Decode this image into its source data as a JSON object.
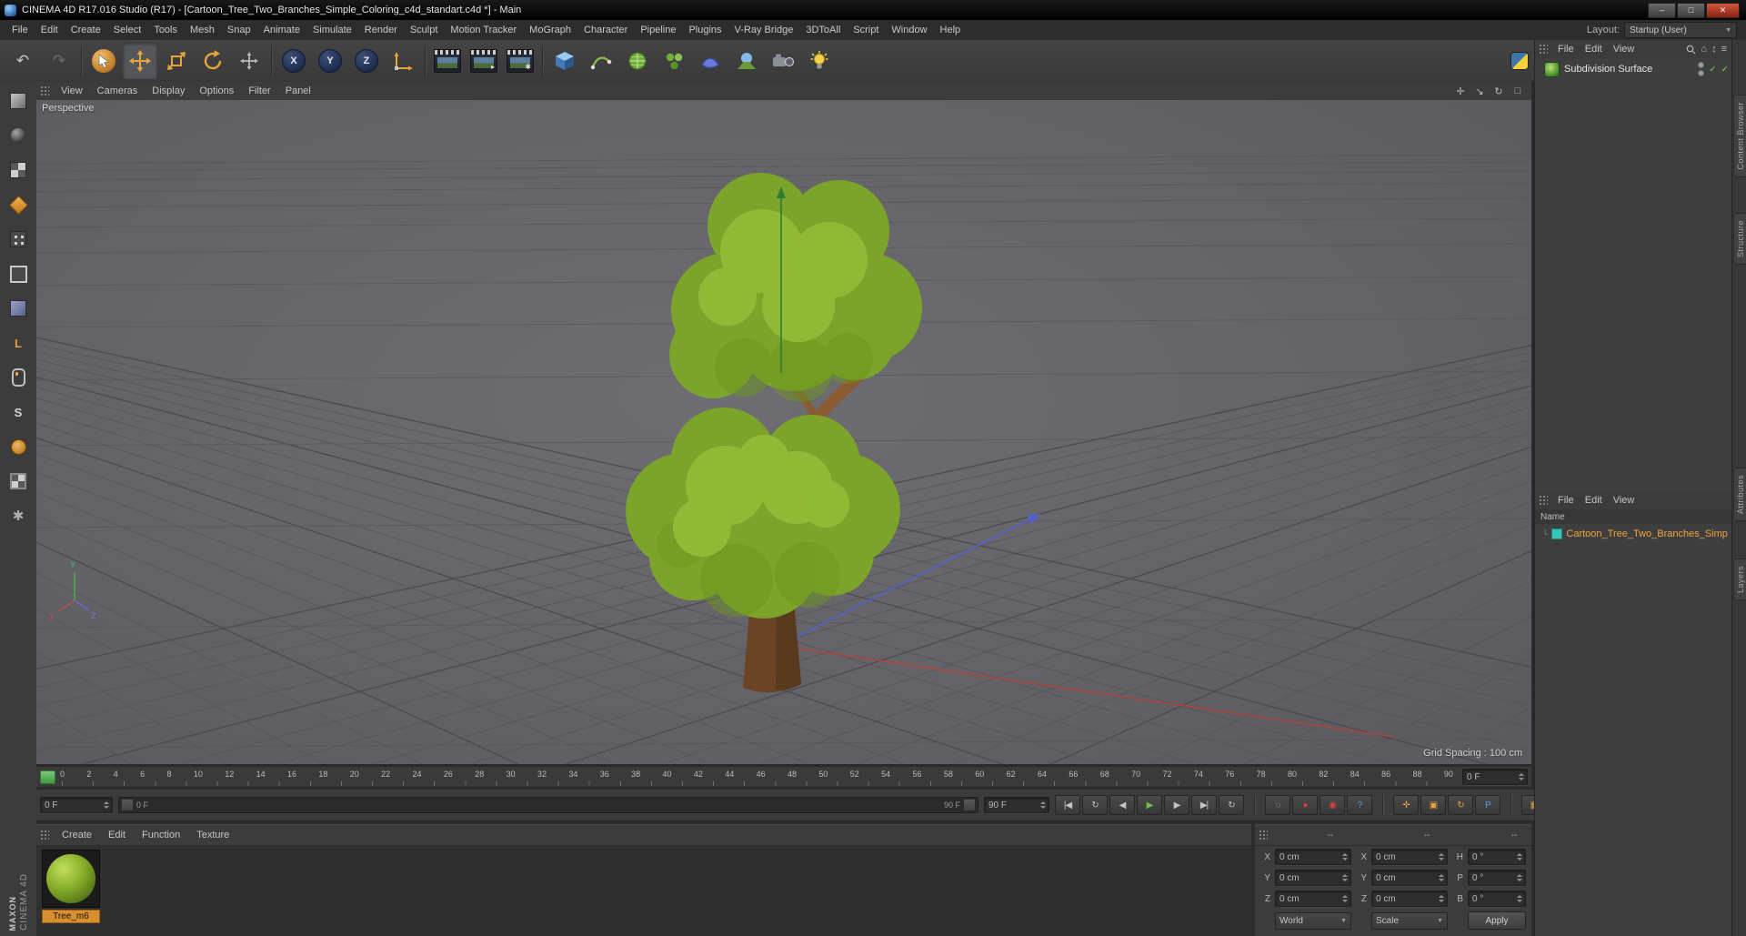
{
  "colors": {
    "accent_orange": "#e8a33c",
    "selection_orange": "#d98e2f",
    "play_green": "#6cc04a",
    "record_red": "#e04040",
    "axis_red": "#a8463c",
    "axis_green": "#2e7d32",
    "axis_blue": "#5560c8",
    "item_teal": "#35c4b5"
  },
  "window": {
    "title": "CINEMA 4D R17.016 Studio (R17) - [Cartoon_Tree_Two_Branches_Simple_Coloring_c4d_standart.c4d *] - Main",
    "minimize": "–",
    "maximize": "□",
    "close": "✕"
  },
  "menubar": {
    "items": [
      "File",
      "Edit",
      "Create",
      "Select",
      "Tools",
      "Mesh",
      "Snap",
      "Animate",
      "Simulate",
      "Render",
      "Sculpt",
      "Motion Tracker",
      "MoGraph",
      "Character",
      "Pipeline",
      "Plugins",
      "V-Ray Bridge",
      "3DToAll",
      "Script",
      "Window",
      "Help"
    ],
    "layout_label": "Layout:",
    "layout_value": "Startup (User)",
    "dropdown_arrow": "▼"
  },
  "toolbar": {
    "undo": "↶",
    "redo": "↷",
    "axis_x": "X",
    "axis_y": "Y",
    "axis_z": "Z",
    "render_settings_badge": "✱",
    "render_pv_badge": "▸"
  },
  "left_palette": {
    "workplane_letter": "L",
    "snap_letter": "S",
    "gear_glyph": "✱"
  },
  "viewport": {
    "menu": [
      "View",
      "Cameras",
      "Display",
      "Options",
      "Filter",
      "Panel"
    ],
    "nav": [
      {
        "name": "pan-view-icon",
        "glyph": "✛"
      },
      {
        "name": "zoom-view-icon",
        "glyph": "↘"
      },
      {
        "name": "rotate-view-icon",
        "glyph": "↻"
      },
      {
        "name": "toggle-view-icon",
        "glyph": "□"
      }
    ],
    "camera_label": "Perspective",
    "grid_spacing": "Grid Spacing : 100 cm",
    "gizmo": {
      "x": "X",
      "y": "Y",
      "z": "Z"
    }
  },
  "timeline": {
    "ticks": [
      "0",
      "2",
      "4",
      "6",
      "8",
      "10",
      "12",
      "14",
      "16",
      "18",
      "20",
      "22",
      "24",
      "26",
      "28",
      "30",
      "32",
      "34",
      "36",
      "38",
      "40",
      "42",
      "44",
      "46",
      "48",
      "50",
      "52",
      "54",
      "56",
      "58",
      "60",
      "62",
      "64",
      "66",
      "68",
      "70",
      "72",
      "74",
      "76",
      "78",
      "80",
      "82",
      "84",
      "86",
      "88",
      "90"
    ],
    "ruler_frame": "0 F",
    "current_frame": "0 F",
    "track_start": "0 F",
    "track_end": "90 F",
    "end_frame": "90 F",
    "transport": [
      {
        "name": "goto-start-button",
        "glyph": "|◀",
        "cls": "g-gray"
      },
      {
        "name": "play-preview-button",
        "glyph": "↻",
        "cls": "g-gray"
      },
      {
        "name": "previous-frame-button",
        "glyph": "◀",
        "cls": "g-gray"
      },
      {
        "name": "play-button",
        "glyph": "▶",
        "cls": "g-green"
      },
      {
        "name": "next-frame-button",
        "glyph": "▶",
        "cls": "g-gray"
      },
      {
        "name": "goto-end-button",
        "glyph": "▶|",
        "cls": "g-gray"
      },
      {
        "name": "loop-button",
        "glyph": "↻",
        "cls": "g-gray"
      }
    ],
    "record": [
      {
        "name": "keyframe-selection-button",
        "glyph": "◌",
        "cls": "g-gray"
      },
      {
        "name": "record-button",
        "glyph": "●",
        "cls": "g-red"
      },
      {
        "name": "autokey-button",
        "glyph": "◉",
        "cls": "g-red"
      },
      {
        "name": "keying-help-button",
        "glyph": "?",
        "cls": "g-blue"
      }
    ],
    "keys": [
      {
        "name": "record-position-button",
        "glyph": "✛",
        "cls": "g-orange"
      },
      {
        "name": "record-scale-button",
        "glyph": "▣",
        "cls": "g-orange"
      },
      {
        "name": "record-rotation-button",
        "glyph": "↻",
        "cls": "g-orange"
      },
      {
        "name": "record-parameter-button",
        "glyph": "P",
        "cls": "g-blue"
      }
    ],
    "extras": [
      {
        "name": "record-pla-button",
        "glyph": "▦",
        "cls": "g-orange"
      },
      {
        "name": "timeline-layout-button",
        "glyph": "▥",
        "cls": "g-gray"
      }
    ]
  },
  "materials": {
    "menu": [
      "Create",
      "Edit",
      "Function",
      "Texture"
    ],
    "items": [
      {
        "name": "Tree_m6"
      }
    ]
  },
  "coordinates": {
    "header": [
      "--",
      "--",
      "--"
    ],
    "rows": [
      {
        "l1": "X",
        "v1": "0 cm",
        "l2": "X",
        "v2": "0 cm",
        "l3": "H",
        "v3": "0 °"
      },
      {
        "l1": "Y",
        "v1": "0 cm",
        "l2": "Y",
        "v2": "0 cm",
        "l3": "P",
        "v3": "0 °"
      },
      {
        "l1": "Z",
        "v1": "0 cm",
        "l2": "Z",
        "v2": "0 cm",
        "l3": "B",
        "v3": "0 °"
      }
    ],
    "position_space": "World",
    "size_mode": "Scale",
    "apply_label": "Apply",
    "dropdown_arrow": "▼"
  },
  "object_manager": {
    "menu": [
      "File",
      "Edit",
      "View"
    ],
    "objects": [
      {
        "name": "Subdivision Surface"
      }
    ],
    "home_glyph": "⌂",
    "updown_glyph": "↕",
    "burger_glyph": "≡",
    "check_glyph": "✓"
  },
  "scene_panel": {
    "menu": [
      "File",
      "Edit",
      "View"
    ],
    "name_header": "Name",
    "tree_glyph": "└",
    "items": [
      {
        "name": "Cartoon_Tree_Two_Branches_Simp"
      }
    ]
  },
  "side_tabs": {
    "top": [
      "Content Browser",
      "Structure"
    ],
    "bottom": [
      "Attributes",
      "Layers"
    ]
  },
  "branding": {
    "maxon": "MAXON",
    "cinema": "CINEMA 4D"
  }
}
